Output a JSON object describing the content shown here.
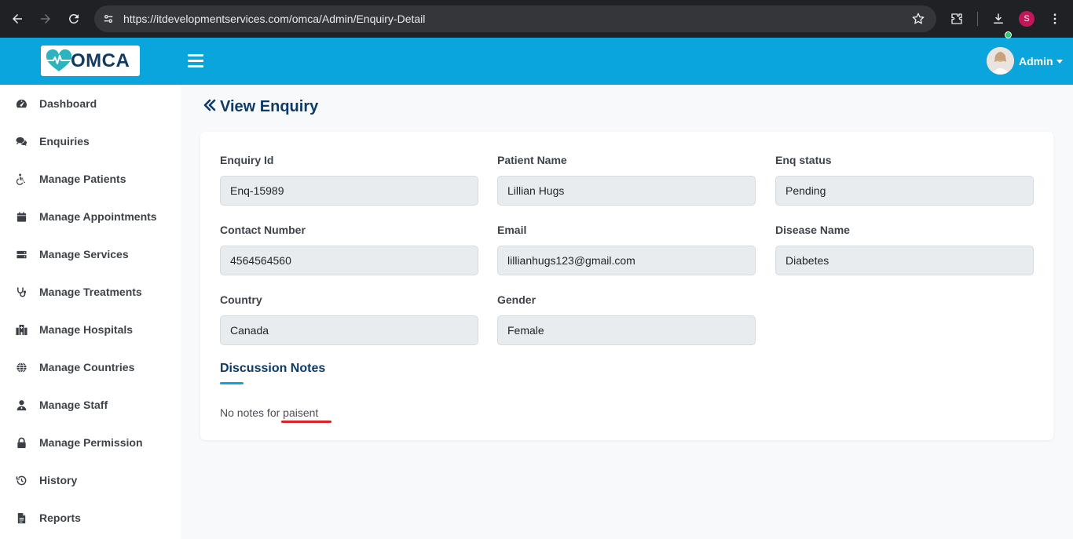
{
  "browser": {
    "url": "https://itdevelopmentservices.com/omca/Admin/Enquiry-Detail",
    "profile_initial": "S"
  },
  "header": {
    "logo_text": "OMCA",
    "user_name": "Admin"
  },
  "sidebar": {
    "items": [
      {
        "label": "Dashboard",
        "icon": "gauge-icon"
      },
      {
        "label": "Enquiries",
        "icon": "comments-icon"
      },
      {
        "label": "Manage Patients",
        "icon": "wheelchair-icon"
      },
      {
        "label": "Manage Appointments",
        "icon": "calendar-icon"
      },
      {
        "label": "Manage Services",
        "icon": "server-icon"
      },
      {
        "label": "Manage Treatments",
        "icon": "stethoscope-icon"
      },
      {
        "label": "Manage Hospitals",
        "icon": "hospital-icon"
      },
      {
        "label": "Manage Countries",
        "icon": "globe-icon"
      },
      {
        "label": "Manage Staff",
        "icon": "user-doctor-icon"
      },
      {
        "label": "Manage Permission",
        "icon": "lock-icon"
      },
      {
        "label": "History",
        "icon": "history-icon"
      },
      {
        "label": "Reports",
        "icon": "file-icon"
      }
    ]
  },
  "page": {
    "title": "View Enquiry"
  },
  "fields": [
    {
      "label": "Enquiry Id",
      "value": "Enq-15989"
    },
    {
      "label": "Patient Name",
      "value": "Lillian Hugs"
    },
    {
      "label": "Enq status",
      "value": "Pending"
    },
    {
      "label": "Contact Number",
      "value": "4564564560"
    },
    {
      "label": "Email",
      "value": "lillianhugs123@gmail.com"
    },
    {
      "label": "Disease Name",
      "value": "Diabetes"
    },
    {
      "label": "Country",
      "value": "Canada"
    },
    {
      "label": "Gender",
      "value": "Female"
    }
  ],
  "discussion": {
    "title": "Discussion Notes",
    "note": "No notes for paisent"
  },
  "colors": {
    "header_bg": "#0ba5de",
    "title": "#0d3b66",
    "spellcheck": "#d9222a"
  }
}
